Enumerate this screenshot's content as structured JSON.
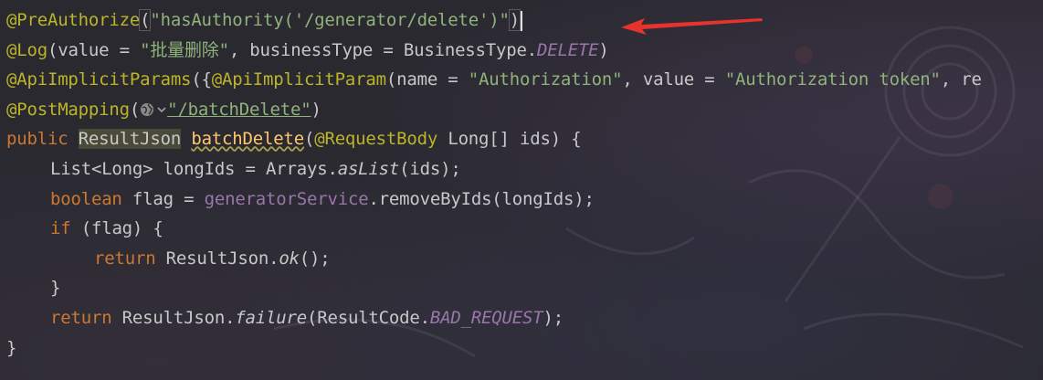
{
  "code": {
    "line1": {
      "ann": "@PreAuthorize",
      "open": "(",
      "str": "\"hasAuthority('/generator/delete')\"",
      "close": ")"
    },
    "line2": {
      "ann": "@Log",
      "a": "(value = ",
      "str": "\"批量删除\"",
      "b": ", businessType = BusinessType.",
      "field": "DELETE",
      "c": ")"
    },
    "line3": {
      "ann1": "@ApiImplicitParams",
      "a": "({",
      "ann2": "@ApiImplicitParam",
      "b": "(name = ",
      "str1": "\"Authorization\"",
      "c": ", value = ",
      "str2": "\"Authorization token\"",
      "d": ", re"
    },
    "line4": {
      "ann": "@PostMapping",
      "a": "(",
      "str": "\"/batchDelete\"",
      "b": ")"
    },
    "line5": {
      "kw": "public",
      "cls": "ResultJson",
      "fn": "batchDelete",
      "a": "(",
      "ann": "@RequestBody",
      "b": " Long[] ids) {"
    },
    "line6": {
      "a": "List<Long> longIds = Arrays.",
      "fn": "asList",
      "b": "(ids);"
    },
    "line7": {
      "kw": "boolean",
      "a": " flag = ",
      "svc": "generatorService",
      "b": ".removeByIds(longIds);"
    },
    "line8": {
      "kw": "if",
      "a": " (flag) {"
    },
    "line9": {
      "kw": "return",
      "a": " ResultJson.",
      "fn": "ok",
      "b": "();"
    },
    "line10": {
      "a": "}"
    },
    "line11": {
      "kw": "return",
      "a": " ResultJson.",
      "fn": "failure",
      "b": "(ResultCode.",
      "field": "BAD_REQUEST",
      "c": ");"
    },
    "line12": {
      "a": "}"
    }
  },
  "icons": {
    "inlay": "globe-icon",
    "inlay_chevron": "chevron-down-icon",
    "annotation": "red-arrow-icon"
  },
  "colors": {
    "annotation": "#bbb529",
    "string": "#8fb37a",
    "keyword": "#cc7832",
    "field": "#9876aa",
    "text": "#c8c8c8",
    "arrow": "#e8332d"
  }
}
